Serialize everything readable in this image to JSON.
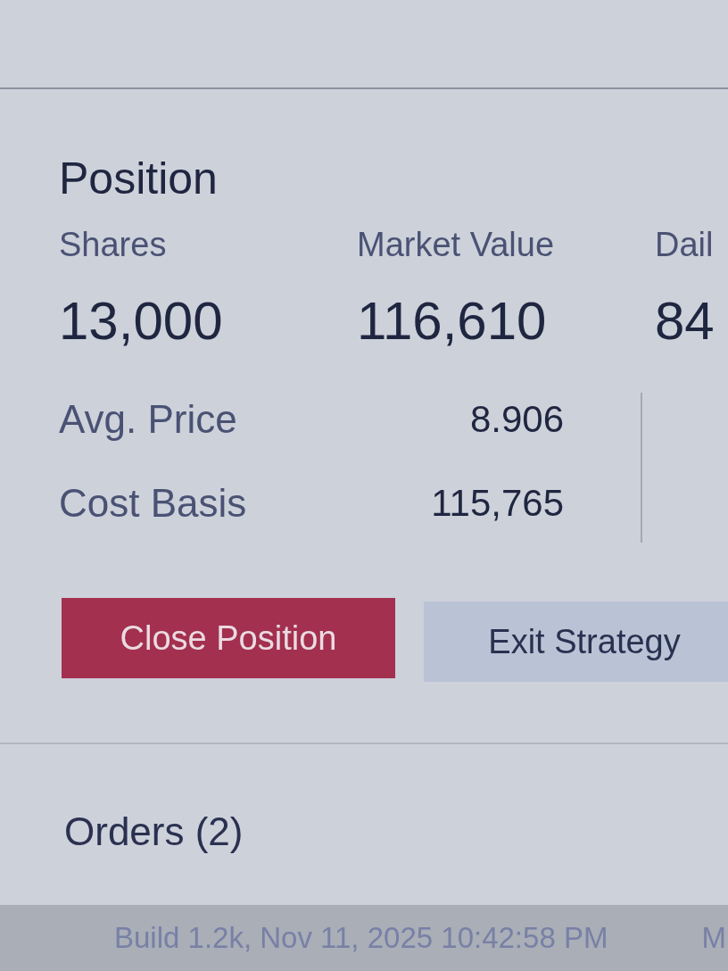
{
  "position": {
    "title": "Position",
    "metrics": [
      {
        "label": "Shares",
        "value": "13,000"
      },
      {
        "label": "Market Value",
        "value": "116,610"
      },
      {
        "label": "Dail",
        "value": "84"
      }
    ],
    "details": [
      {
        "label": "Avg. Price",
        "value": "8.906"
      },
      {
        "label": "Cost Basis",
        "value": "115,765"
      }
    ]
  },
  "actions": [
    {
      "label": "Close Position",
      "kind": "danger"
    },
    {
      "label": "Exit Strategy",
      "kind": "secondary"
    }
  ],
  "orders": {
    "title": "Orders (2)"
  },
  "footer": {
    "build": "Build 1.2k, Nov 11, 2025 10:42:58 PM",
    "column_2": "M"
  }
}
